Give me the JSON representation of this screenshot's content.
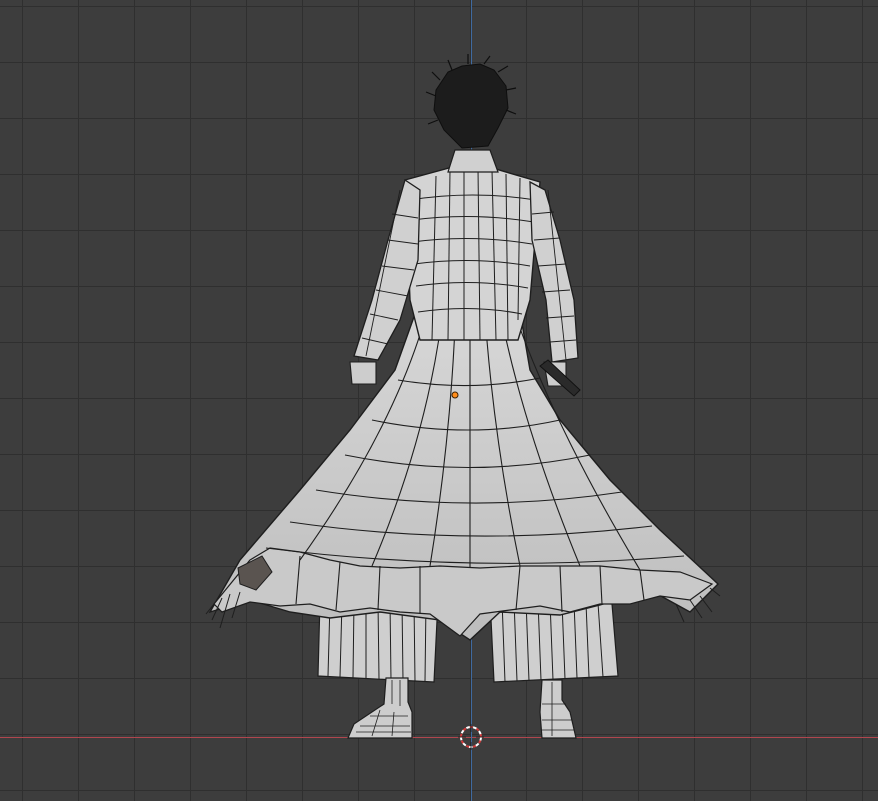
{
  "viewport": {
    "background": "#3d3d3d",
    "grid_color": "#2f2f2f",
    "x_axis_color": "#b0464e",
    "y_axis_color": "#3f6aa0",
    "object_color": "#d2d2d2",
    "wire_color": "#1e1e1e",
    "origin_color": "#ff8c1a"
  },
  "object": {
    "name_icon": "character-mesh",
    "mode": "edit-wireframe-overlay"
  },
  "cursor": {
    "icon": "3d-cursor-icon"
  }
}
